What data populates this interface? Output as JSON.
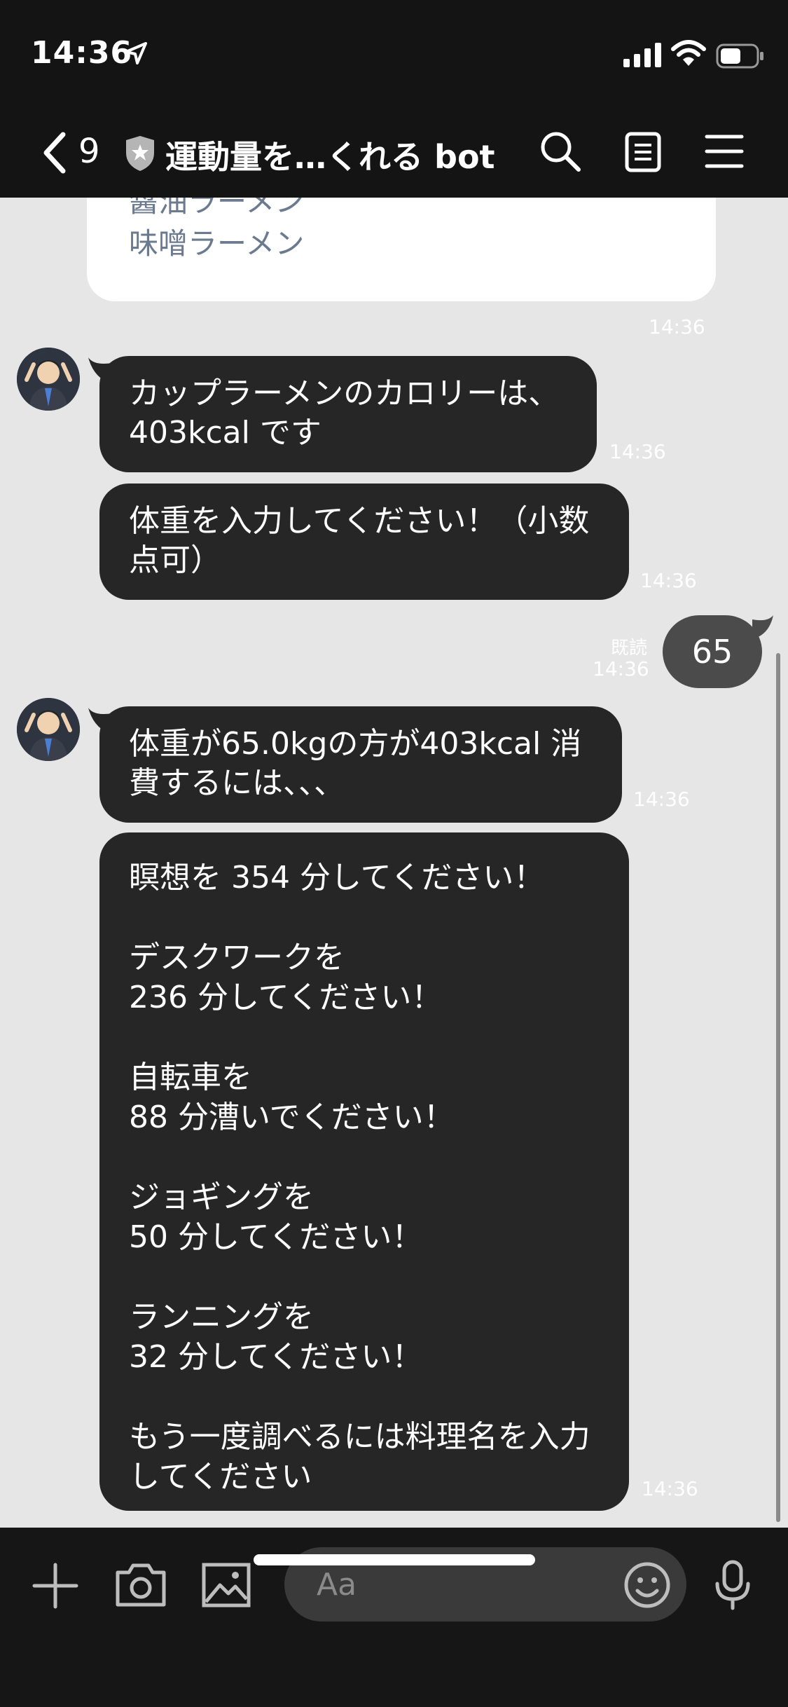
{
  "status_bar": {
    "time": "14:36",
    "icons": [
      "location-arrow-icon",
      "cellular-signal-icon",
      "wifi-icon",
      "battery-icon"
    ]
  },
  "header": {
    "back_count": "9",
    "title": "運動量を…くれる bot",
    "icons": [
      "chevron-left-icon",
      "shield-star-icon",
      "search-icon",
      "notes-icon",
      "menu-icon"
    ]
  },
  "messages": {
    "flex_items": [
      "醤油ラーメン",
      "味噌ラーメン"
    ],
    "flex_time": "14:36",
    "calorie": {
      "text": "カップラーメンのカロリーは、\n403kcal です",
      "time": "14:36"
    },
    "weight_prompt": {
      "text": "体重を入力してください！（小数\n点可）",
      "time": "14:36"
    },
    "user_reply": {
      "text": "65",
      "read": "既読",
      "time": "14:36"
    },
    "intro": {
      "text": "体重が65.0kgの方が403kcal 消\n費するには、、、",
      "time": "14:36"
    },
    "exercise": {
      "text": "瞑想を 354 分してください！\n\nデスクワークを\n236 分してください！\n\n自転車を\n88 分漕いでください！\n\nジョギングを\n50 分してください！\n\nランニングを\n32 分してください！\n\nもう一度調べるには料理名を入力\nしてください",
      "time": "14:36"
    }
  },
  "input_bar": {
    "placeholder": "Aa",
    "icons": [
      "plus-icon",
      "camera-icon",
      "image-icon",
      "emoji-icon",
      "microphone-icon"
    ]
  },
  "colors": {
    "background": "#e6e6e6",
    "bar": "#141414",
    "bot_bubble": "#262626",
    "user_bubble": "#4b4b4b",
    "flex_text": "#6b7a8f"
  }
}
